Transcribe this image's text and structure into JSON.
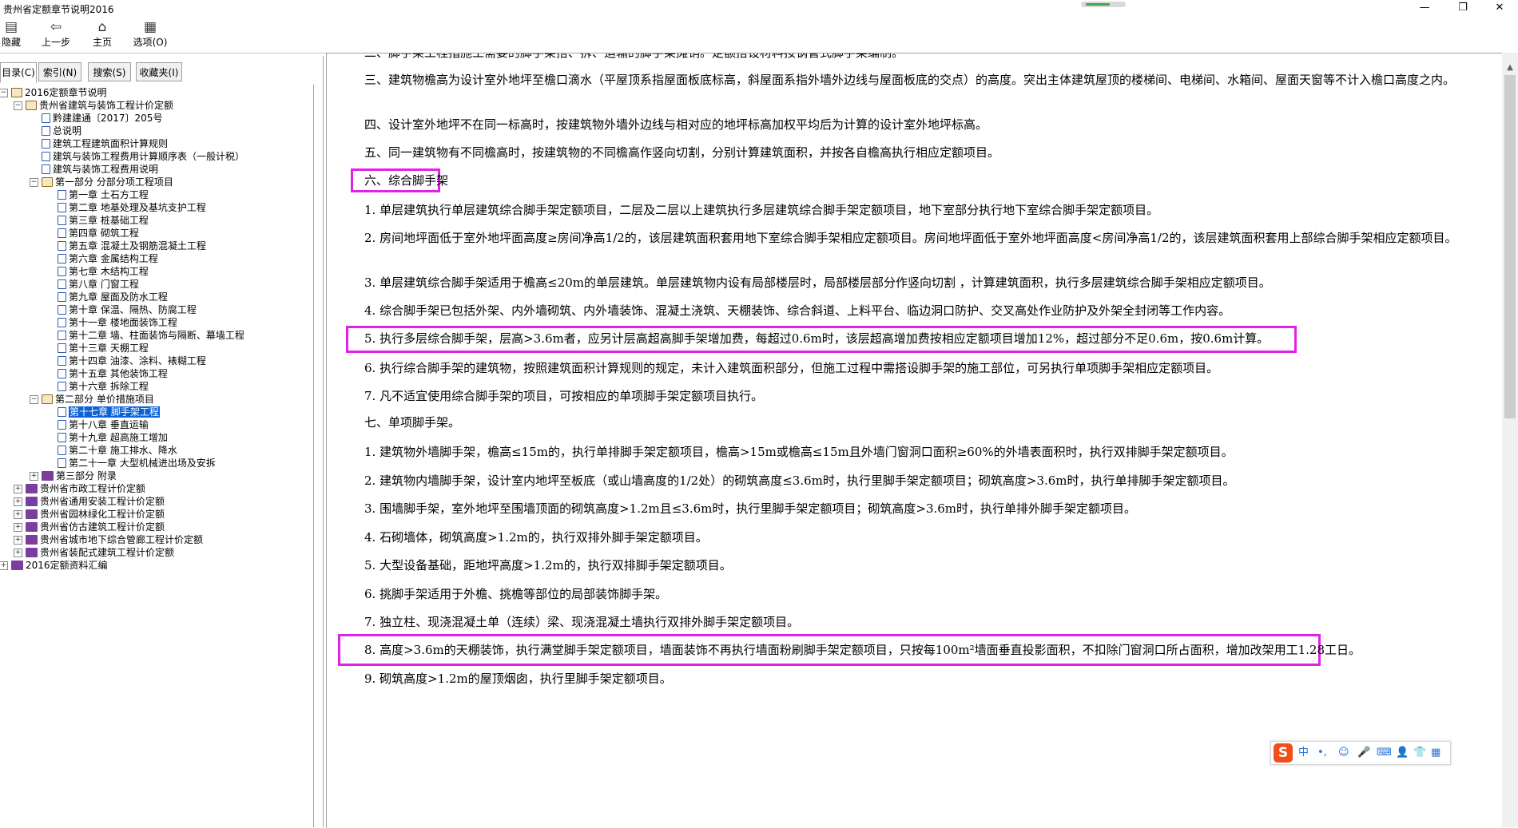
{
  "window": {
    "title": "贵州省定额章节说明2016",
    "minimize": "—",
    "maximize": "❐",
    "close": "✕"
  },
  "toolbar": [
    {
      "label": "隐藏",
      "icon": "hide-icon",
      "glyph": "▤"
    },
    {
      "label": "上一步",
      "icon": "back-icon",
      "glyph": "⇦"
    },
    {
      "label": "主页",
      "icon": "home-icon",
      "glyph": "⌂"
    },
    {
      "label": "选项(O)",
      "icon": "options-icon",
      "glyph": "▦"
    }
  ],
  "tabs": [
    "目录(C)",
    "索引(N)",
    "搜索(S)",
    "收藏夹(I)"
  ],
  "tree": [
    {
      "label": "2016定额章节说明",
      "level": 0,
      "type": "open",
      "toggle": "−"
    },
    {
      "label": "贵州省建筑与装饰工程计价定额",
      "level": 1,
      "type": "open",
      "toggle": "−"
    },
    {
      "label": "黔建建通〔2017〕205号",
      "level": 2,
      "type": "page"
    },
    {
      "label": "总说明",
      "level": 2,
      "type": "page"
    },
    {
      "label": "建筑工程建筑面积计算规则",
      "level": 2,
      "type": "page"
    },
    {
      "label": "建筑与装饰工程费用计算顺序表（一般计税）",
      "level": 2,
      "type": "page"
    },
    {
      "label": "建筑与装饰工程费用说明",
      "level": 2,
      "type": "page"
    },
    {
      "label": "第一部分 分部分项工程项目",
      "level": 2,
      "type": "open",
      "toggle": "−"
    },
    {
      "label": "第一章 土石方工程",
      "level": 3,
      "type": "page"
    },
    {
      "label": "第二章 地基处理及基坑支护工程",
      "level": 3,
      "type": "page"
    },
    {
      "label": "第三章 桩基础工程",
      "level": 3,
      "type": "page"
    },
    {
      "label": "第四章 砌筑工程",
      "level": 3,
      "type": "page"
    },
    {
      "label": "第五章 混凝土及钢筋混凝土工程",
      "level": 3,
      "type": "page"
    },
    {
      "label": "第六章 金属结构工程",
      "level": 3,
      "type": "page"
    },
    {
      "label": "第七章 木结构工程",
      "level": 3,
      "type": "page"
    },
    {
      "label": "第八章 门窗工程",
      "level": 3,
      "type": "page"
    },
    {
      "label": "第九章 屋面及防水工程",
      "level": 3,
      "type": "page"
    },
    {
      "label": "第十章 保温、隔热、防腐工程",
      "level": 3,
      "type": "page"
    },
    {
      "label": "第十一章 楼地面装饰工程",
      "level": 3,
      "type": "page"
    },
    {
      "label": "第十二章 墙、柱面装饰与隔断、幕墙工程",
      "level": 3,
      "type": "page"
    },
    {
      "label": "第十三章 天棚工程",
      "level": 3,
      "type": "page"
    },
    {
      "label": "第十四章 油漆、涂料、裱糊工程",
      "level": 3,
      "type": "page"
    },
    {
      "label": "第十五章 其他装饰工程",
      "level": 3,
      "type": "page"
    },
    {
      "label": "第十六章 拆除工程",
      "level": 3,
      "type": "page"
    },
    {
      "label": "第二部分 单价措施项目",
      "level": 2,
      "type": "open",
      "toggle": "−"
    },
    {
      "label": "第十七章 脚手架工程",
      "level": 3,
      "type": "page",
      "selected": true
    },
    {
      "label": "第十八章 垂直运输",
      "level": 3,
      "type": "page"
    },
    {
      "label": "第十九章 超高施工增加",
      "level": 3,
      "type": "page"
    },
    {
      "label": "第二十章 施工排水、降水",
      "level": 3,
      "type": "page"
    },
    {
      "label": "第二十一章 大型机械进出场及安拆",
      "level": 3,
      "type": "page"
    },
    {
      "label": "第三部分 附录",
      "level": 2,
      "type": "closed",
      "toggle": "+"
    },
    {
      "label": "贵州省市政工程计价定额",
      "level": 1,
      "type": "closed",
      "toggle": "+"
    },
    {
      "label": "贵州省通用安装工程计价定额",
      "level": 1,
      "type": "closed",
      "toggle": "+"
    },
    {
      "label": "贵州省园林绿化工程计价定额",
      "level": 1,
      "type": "closed",
      "toggle": "+"
    },
    {
      "label": "贵州省仿古建筑工程计价定额",
      "level": 1,
      "type": "closed",
      "toggle": "+"
    },
    {
      "label": "贵州省城市地下综合管廊工程计价定额",
      "level": 1,
      "type": "closed",
      "toggle": "+"
    },
    {
      "label": "贵州省装配式建筑工程计价定额",
      "level": 1,
      "type": "closed",
      "toggle": "+"
    },
    {
      "label": "2016定额资料汇编",
      "level": 0,
      "type": "closed",
      "toggle": "+"
    }
  ],
  "content": [
    {
      "text": "二、脚手架工程指施工需要的脚手架搭、拆、运输的脚手架摊销。定额搭设材料按钢管式脚手架编制。"
    },
    {
      "text": "三、建筑物檐高为设计室外地坪至檐口滴水（平屋顶系指屋面板底标高，斜屋面系指外墙外边线与屋面板底的交点）的高度。突出主体建筑屋顶的楼梯间、电梯间、水箱间、屋面天窗等不计入檐口高度之内。"
    },
    {
      "text": "四、设计室外地坪不在同一标高时，按建筑物外墙外边线与相对应的地坪标高加权平均后为计算的设计室外地坪标高。"
    },
    {
      "text": "五、同一建筑物有不同檐高时，按建筑物的不同檐高作竖向切割，分别计算建筑面积，并按各自檐高执行相应定额项目。"
    },
    {
      "text": "六、综合脚手架",
      "highlight": true
    },
    {
      "text": "1. 单层建筑执行单层建筑综合脚手架定额项目，二层及二层以上建筑执行多层建筑综合脚手架定额项目，地下室部分执行地下室综合脚手架定额项目。"
    },
    {
      "text": "2. 房间地坪面低于室外地坪面高度≥房间净高1/2的，该层建筑面积套用地下室综合脚手架相应定额项目。房间地坪面低于室外地坪面高度<房间净高1/2的，该层建筑面积套用上部综合脚手架相应定额项目。"
    },
    {
      "text": "3. 单层建筑综合脚手架适用于檐高≤20m的单层建筑。单层建筑物内设有局部楼层时，局部楼层部分作竖向切割 ，计算建筑面积，执行多层建筑综合脚手架相应定额项目。"
    },
    {
      "text": "4. 综合脚手架已包括外架、内外墙砌筑、内外墙装饰、混凝土浇筑、天棚装饰、综合斜道、上料平台、临边洞口防护、交叉高处作业防护及外架全封闭等工作内容。"
    },
    {
      "text": "5. 执行多层综合脚手架，层高>3.6m者，应另计层高超高脚手架增加费，每超过0.6m时，该层超高增加费按相应定额项目增加12%，超过部分不足0.6m，按0.6m计算。",
      "highlight": true
    },
    {
      "text": "6. 执行综合脚手架的建筑物，按照建筑面积计算规则的规定，未计入建筑面积部分，但施工过程中需搭设脚手架的施工部位，可另执行单项脚手架相应定额项目。"
    },
    {
      "text": "7. 凡不适宜使用综合脚手架的项目，可按相应的单项脚手架定额项目执行。"
    },
    {
      "text": "七、单项脚手架。"
    },
    {
      "text": "1. 建筑物外墙脚手架，檐高≤15m的，执行单排脚手架定额项目，檐高>15m或檐高≤15m且外墙门窗洞口面积≥60%的外墙表面积时，执行双排脚手架定额项目。"
    },
    {
      "text": "2. 建筑物内墙脚手架，设计室内地坪至板底（或山墙高度的1/2处）的砌筑高度≤3.6m时，执行里脚手架定额项目；砌筑高度>3.6m时，执行单排脚手架定额项目。"
    },
    {
      "text": "3. 围墙脚手架，室外地坪至围墙顶面的砌筑高度>1.2m且≤3.6m时，执行里脚手架定额项目；砌筑高度>3.6m时，执行单排外脚手架定额项目。"
    },
    {
      "text": "4. 石砌墙体，砌筑高度>1.2m的，执行双排外脚手架定额项目。"
    },
    {
      "text": "5. 大型设备基础，距地坪高度>1.2m的，执行双排脚手架定额项目。"
    },
    {
      "text": "6. 挑脚手架适用于外檐、挑檐等部位的局部装饰脚手架。"
    },
    {
      "text": "7. 独立柱、现浇混凝土单（连续）梁、现浇混凝土墙执行双排外脚手架定额项目。"
    },
    {
      "text": "8. 高度>3.6m的天棚装饰，执行满堂脚手架定额项目，墙面装饰不再执行墙面粉刷脚手架定额项目，只按每100m²墙面垂直投影面积，不扣除门窗洞口所占面积，增加改架用工1.28工日。",
      "highlight": true
    },
    {
      "text": "9. 砌筑高度>1.2m的屋顶烟囱，执行里脚手架定额项目。"
    }
  ],
  "ime": {
    "logo": "S",
    "mode": "中",
    "punct": "•,",
    "items": [
      "☺",
      "🎤",
      "⌨",
      "👤",
      "👕",
      "▦"
    ]
  },
  "colors": {
    "highlight": "#e221e8",
    "selection": "#0a62d6"
  }
}
